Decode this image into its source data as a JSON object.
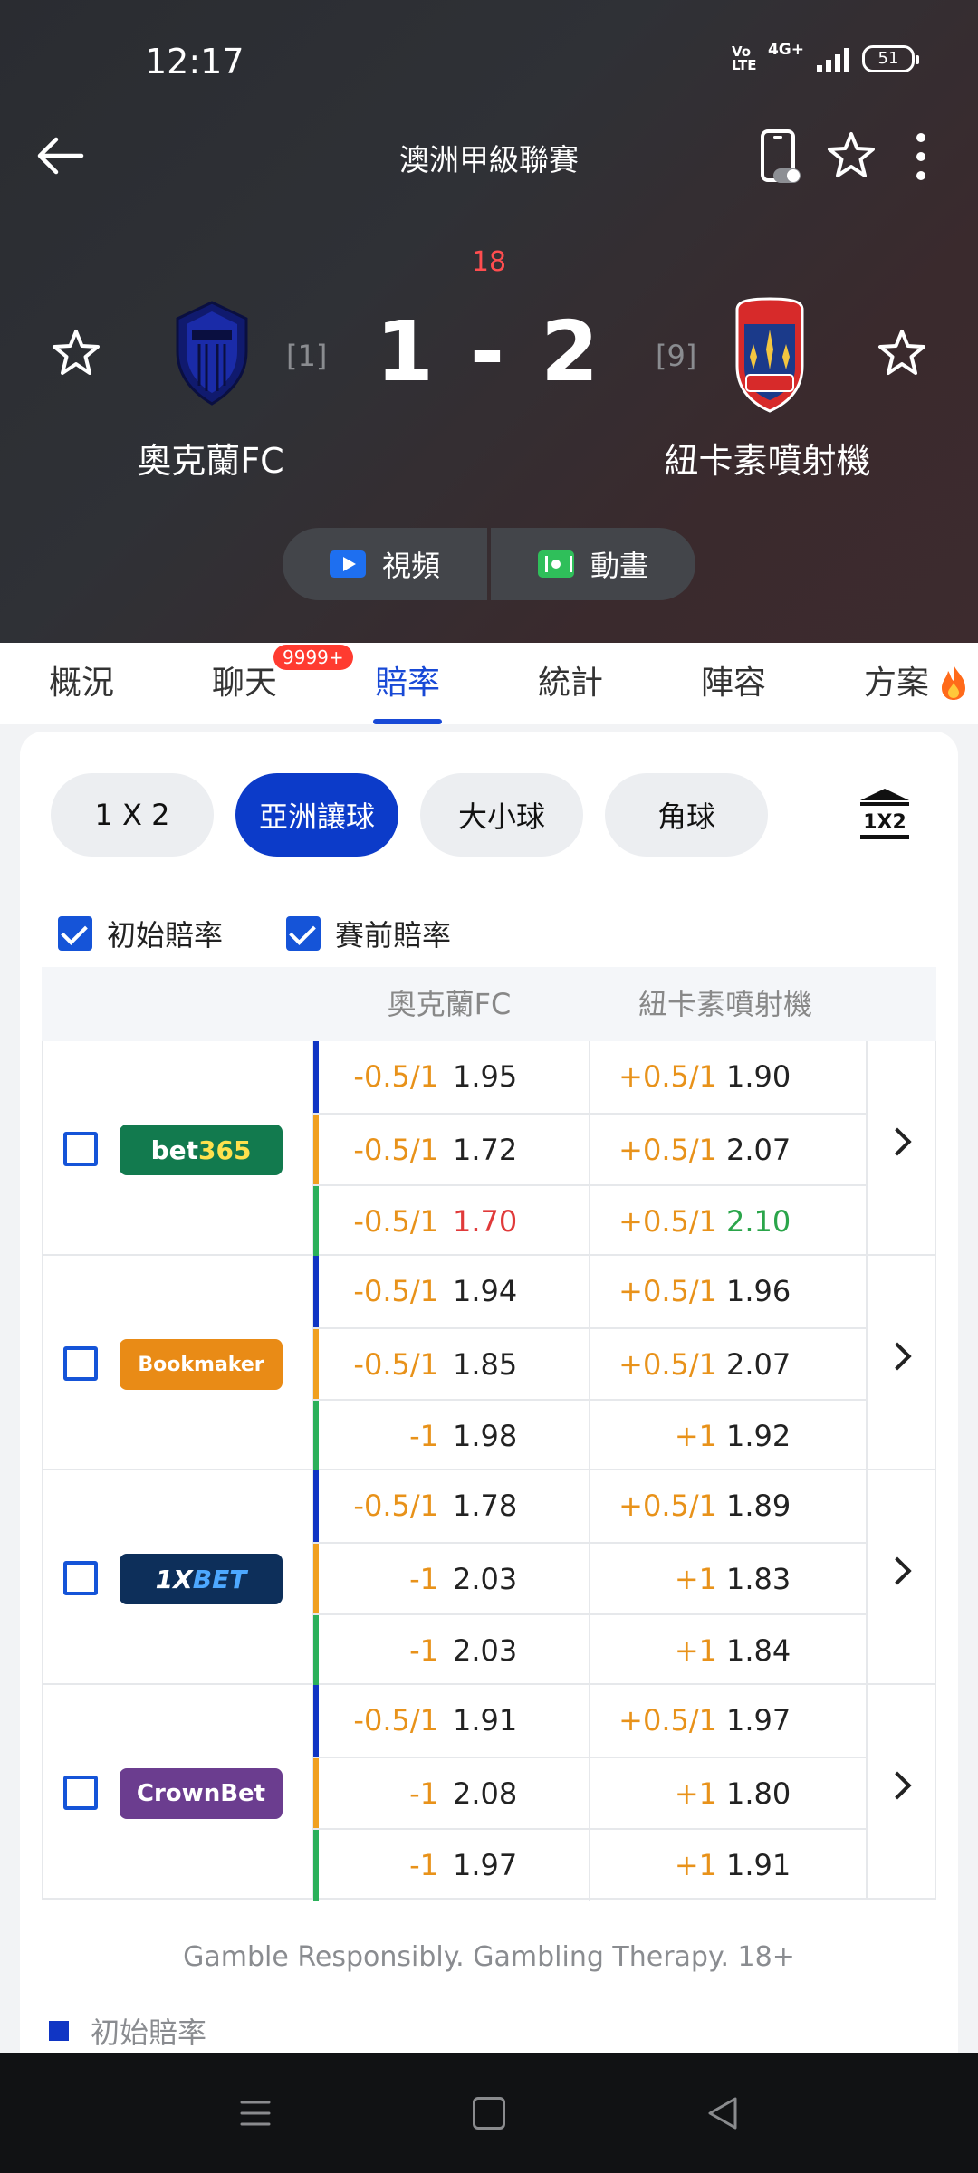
{
  "status_bar": {
    "time": "12:17",
    "volte": "Vo LTE",
    "network": "4G+",
    "battery": "51"
  },
  "header": {
    "league": "澳洲甲級聯賽",
    "minute": "18",
    "score": "1 - 2"
  },
  "home": {
    "name": "奧克蘭FC",
    "rank": "[1]"
  },
  "away": {
    "name": "紐卡素噴射機",
    "rank": "[9]"
  },
  "media": {
    "video_label": "視頻",
    "animation_label": "動畫"
  },
  "tabs": [
    "概況",
    "聊天",
    "賠率",
    "統計",
    "陣容",
    "方案"
  ],
  "chat_badge": "9999+",
  "market_tabs": [
    "1 X 2",
    "亞洲讓球",
    "大小球",
    "角球"
  ],
  "checks": {
    "opening": "初始賠率",
    "prematch": "賽前賠率"
  },
  "table_header": {
    "home": "奧克蘭FC",
    "away": "紐卡素噴射機"
  },
  "bookmakers": [
    {
      "name": "bet365",
      "rows": [
        {
          "home_hcap": "-0.5/1",
          "home_odd": "1.95",
          "away_hcap": "+0.5/1",
          "away_odd": "1.90"
        },
        {
          "home_hcap": "-0.5/1",
          "home_odd": "1.72",
          "away_hcap": "+0.5/1",
          "away_odd": "2.07"
        },
        {
          "home_hcap": "-0.5/1",
          "home_odd": "1.70",
          "away_hcap": "+0.5/1",
          "away_odd": "2.10"
        }
      ]
    },
    {
      "name": "Bookmaker",
      "rows": [
        {
          "home_hcap": "-0.5/1",
          "home_odd": "1.94",
          "away_hcap": "+0.5/1",
          "away_odd": "1.96"
        },
        {
          "home_hcap": "-0.5/1",
          "home_odd": "1.85",
          "away_hcap": "+0.5/1",
          "away_odd": "2.07"
        },
        {
          "home_hcap": "-1",
          "home_odd": "1.98",
          "away_hcap": "+1",
          "away_odd": "1.92"
        }
      ]
    },
    {
      "name": "1XBET",
      "rows": [
        {
          "home_hcap": "-0.5/1",
          "home_odd": "1.78",
          "away_hcap": "+0.5/1",
          "away_odd": "1.89"
        },
        {
          "home_hcap": "-1",
          "home_odd": "2.03",
          "away_hcap": "+1",
          "away_odd": "1.83"
        },
        {
          "home_hcap": "-1",
          "home_odd": "2.03",
          "away_hcap": "+1",
          "away_odd": "1.84"
        }
      ]
    },
    {
      "name": "CrownBet",
      "rows": [
        {
          "home_hcap": "-0.5/1",
          "home_odd": "1.91",
          "away_hcap": "+0.5/1",
          "away_odd": "1.97"
        },
        {
          "home_hcap": "-1",
          "home_odd": "2.08",
          "away_hcap": "+1",
          "away_odd": "1.80"
        },
        {
          "home_hcap": "-1",
          "home_odd": "1.97",
          "away_hcap": "+1",
          "away_odd": "1.91"
        }
      ]
    }
  ],
  "gamble_notice": "Gamble Responsibly. Gambling Therapy. 18+",
  "legend": {
    "opening": "初始賠率"
  },
  "colors": {
    "accent": "#1849d6",
    "odds_up": "#2aa54a",
    "odds_down": "#e03a3a",
    "handicap": "#e8921a"
  }
}
